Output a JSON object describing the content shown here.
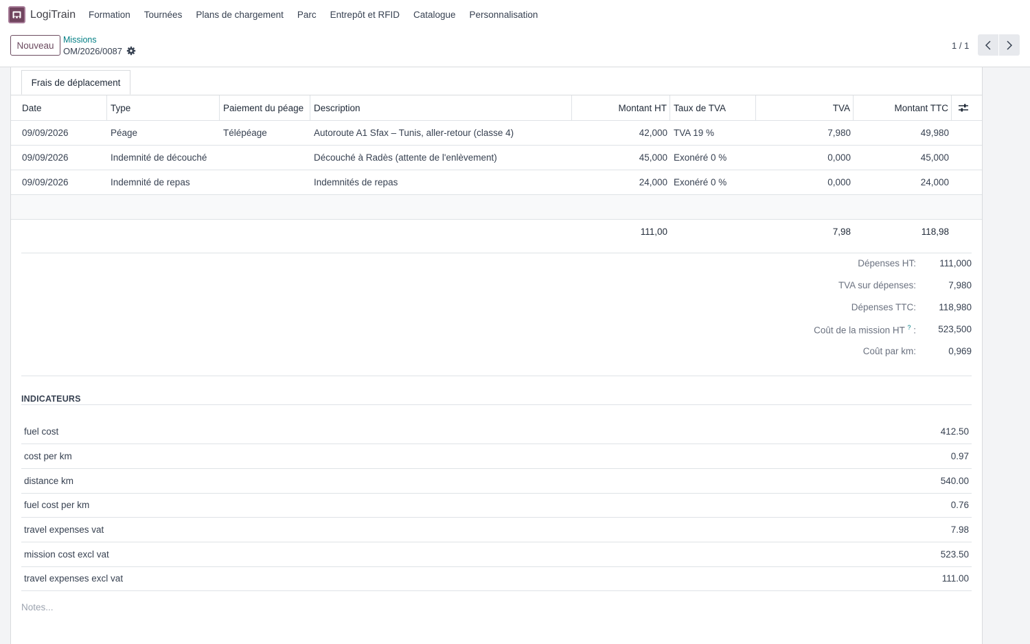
{
  "app": {
    "name": "LogiTrain",
    "logo_icon": "truck-icon",
    "brand_color": "#71455f",
    "link_color": "#017e84"
  },
  "menu": [
    "Formation",
    "Tournées",
    "Plans de chargement",
    "Parc",
    "Entrepôt et RFID",
    "Catalogue",
    "Personnalisation"
  ],
  "control_panel": {
    "new_button": "Nouveau",
    "breadcrumb": "Missions",
    "record": "OM/2026/0087",
    "pager": "1 / 1"
  },
  "tab": {
    "label": "Frais de déplacement"
  },
  "expenses": {
    "columns": {
      "date": "Date",
      "type": "Type",
      "payment": "Paiement du péage",
      "description": "Description",
      "amount_ht": "Montant HT",
      "vat_rate": "Taux de TVA",
      "vat": "TVA",
      "amount_ttc": "Montant TTC"
    },
    "rows": [
      {
        "date": "09/09/2026",
        "type": "Péage",
        "payment": "Télépéage",
        "description": "Autoroute A1 Sfax – Tunis, aller-retour (classe 4)",
        "amount_ht": "42,000",
        "vat_rate": "TVA 19 %",
        "vat": "7,980",
        "amount_ttc": "49,980"
      },
      {
        "date": "09/09/2026",
        "type": "Indemnité de découché",
        "payment": "",
        "description": "Découché à Radès (attente de l'enlèvement)",
        "amount_ht": "45,000",
        "vat_rate": "Exonéré 0 %",
        "vat": "0,000",
        "amount_ttc": "45,000"
      },
      {
        "date": "09/09/2026",
        "type": "Indemnité de repas",
        "payment": "",
        "description": "Indemnités de repas",
        "amount_ht": "24,000",
        "vat_rate": "Exonéré 0 %",
        "vat": "0,000",
        "amount_ttc": "24,000"
      }
    ],
    "totals": {
      "amount_ht": "111,00",
      "vat": "7,98",
      "amount_ttc": "118,98"
    }
  },
  "summary": [
    {
      "label": "Dépenses HT:",
      "value": "111,000"
    },
    {
      "label": "TVA sur dépenses:",
      "value": "7,980"
    },
    {
      "label": "Dépenses TTC:",
      "value": "118,980"
    },
    {
      "label": "Coût de la mission HT",
      "help": "?",
      "suffix": ":",
      "value": "523,500"
    },
    {
      "label": "Coût par km:",
      "value": "0,969"
    }
  ],
  "indicators": {
    "title": "INDICATEURS",
    "items": [
      {
        "label": "fuel cost",
        "value": "412.50"
      },
      {
        "label": "cost per km",
        "value": "0.97"
      },
      {
        "label": "distance km",
        "value": "540.00"
      },
      {
        "label": "fuel cost per km",
        "value": "0.76"
      },
      {
        "label": "travel expenses vat",
        "value": "7.98"
      },
      {
        "label": "mission cost excl vat",
        "value": "523.50"
      },
      {
        "label": "travel expenses excl vat",
        "value": "111.00"
      }
    ]
  },
  "notes": {
    "placeholder": "Notes..."
  }
}
